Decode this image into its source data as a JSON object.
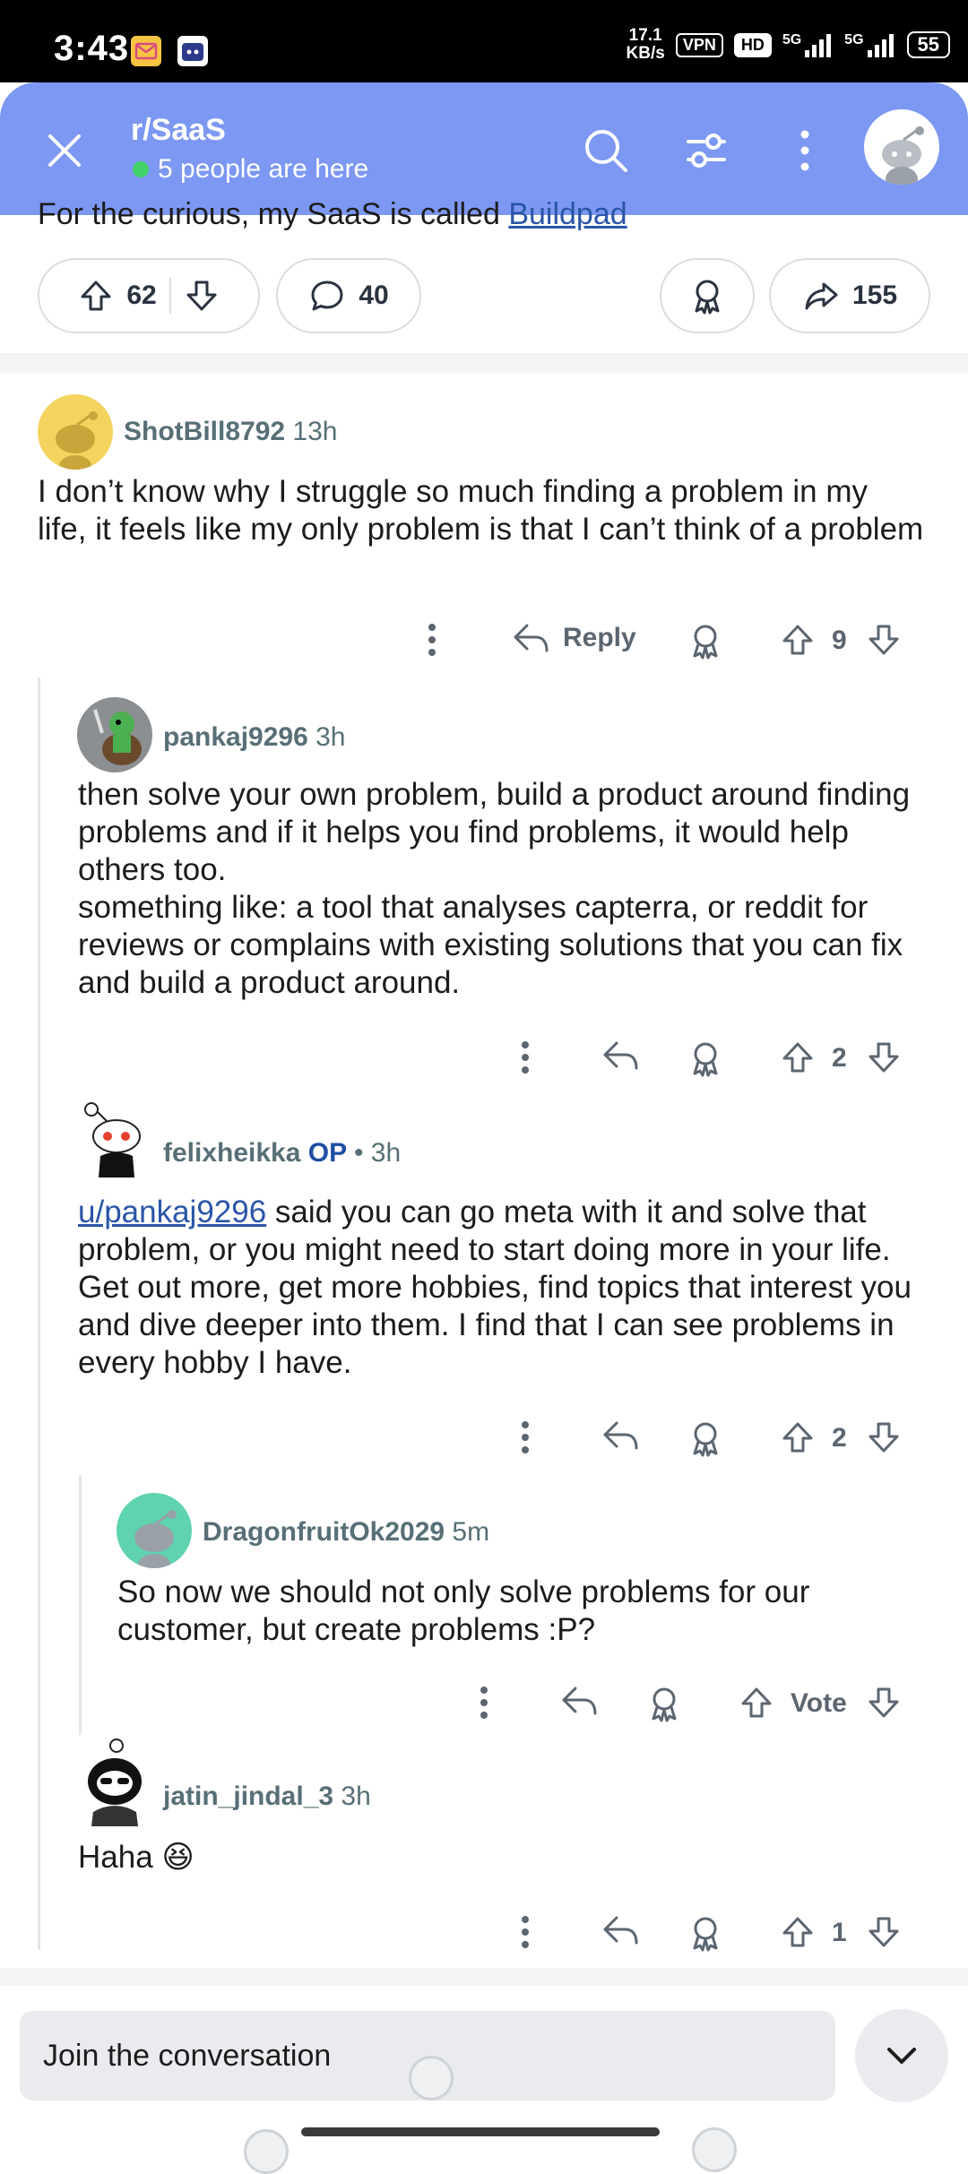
{
  "status_bar": {
    "time": "3:43",
    "speed_value": "17.1",
    "speed_unit": "KB/s",
    "vpn": "VPN",
    "hd": "HD",
    "net1": "5G",
    "net2": "5G",
    "battery": "55"
  },
  "header": {
    "title": "r/SaaS",
    "presence": "5 people are here"
  },
  "post": {
    "cut_text": "For the curious, my SaaS is called ",
    "cut_link": "Buildpad",
    "upvotes": "62",
    "comments": "40",
    "shares": "155"
  },
  "comments": [
    {
      "author": "ShotBill8792",
      "time": "13h",
      "body": "I don’t know why I struggle so much finding a problem in my life, it feels like my only problem is that I can’t think of a problem",
      "reply_label": "Reply",
      "votes": "9"
    },
    {
      "author": "pankaj9296",
      "time": "3h",
      "body_line1": "then solve your own problem, build a product around finding problems and if it helps you find problems, it would help others too.",
      "body_line2": "something like: a tool that analyses capterra, or reddit for reviews or complains with existing solutions that you can fix and build a product around.",
      "votes": "2"
    },
    {
      "author": "felixheikka",
      "op_badge": "OP",
      "time": "• 3h",
      "mention": "u/pankaj9296",
      "body": " said you can go meta with it and solve that problem, or you might need to start doing more in your life. Get out more, get more hobbies, find topics that interest you and dive deeper into them. I find that I can see problems in every hobby I have.",
      "votes": "2"
    },
    {
      "author": "DragonfruitOk2029",
      "time": "5m",
      "body": "So now we should not only solve problems for our customer, but create problems :P?",
      "votes": "Vote"
    },
    {
      "author": "jatin_jindal_3",
      "time": "3h",
      "body": "Haha",
      "emoji": "😆",
      "votes": "1"
    }
  ],
  "composer": {
    "placeholder": "Join the conversation"
  },
  "colors": {
    "header_bg": "#7c98f2",
    "presence_dot": "#43d36a",
    "op_badge": "#1f4ea3",
    "link": "#2a55a7"
  }
}
